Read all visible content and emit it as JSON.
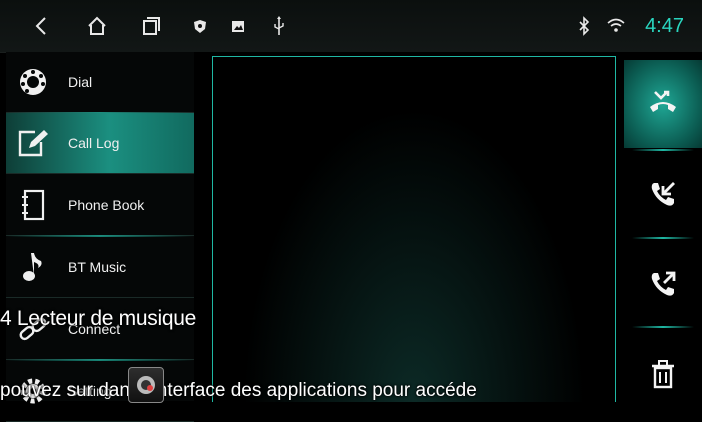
{
  "status_bar": {
    "time": "4:47",
    "icons": [
      "back-icon",
      "home-icon",
      "recent-apps-icon",
      "shield-icon",
      "image-icon",
      "usb-icon",
      "bluetooth-icon",
      "wifi-icon"
    ]
  },
  "sidebar": {
    "items": [
      {
        "label": "Dial",
        "icon": "dial-icon",
        "active": false
      },
      {
        "label": "Call Log",
        "icon": "call-log-icon",
        "active": true
      },
      {
        "label": "Phone Book",
        "icon": "phone-book-icon",
        "active": false
      },
      {
        "label": "BT Music",
        "icon": "music-note-icon",
        "active": false
      },
      {
        "label": "Connect",
        "icon": "link-icon",
        "active": false
      },
      {
        "label": "Setting",
        "icon": "gear-icon",
        "active": false
      }
    ]
  },
  "right_bar": {
    "buttons": [
      {
        "icon": "missed-call-icon",
        "active": true
      },
      {
        "icon": "incoming-call-icon",
        "active": false
      },
      {
        "icon": "outgoing-call-icon",
        "active": false
      },
      {
        "icon": "delete-icon",
        "active": false
      }
    ]
  },
  "overlay": {
    "title": "4 Lecteur de musique",
    "caption": "pouvez sur          dans l'interface des applications pour accéde"
  },
  "colors": {
    "accent": "#1fb7a3",
    "clock": "#2ad5bf"
  }
}
